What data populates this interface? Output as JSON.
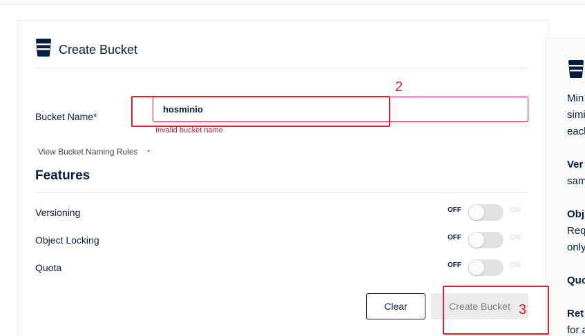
{
  "form": {
    "title": "Create Bucket",
    "bucket_name_label": "Bucket Name*",
    "bucket_name_value": "hosminio",
    "error": "Invalid bucket name",
    "naming_rules_link": "View Bucket Naming Rules",
    "features_heading": "Features",
    "features": [
      {
        "label": "Versioning",
        "off": "OFF",
        "on": "ON",
        "enabled": false
      },
      {
        "label": "Object Locking",
        "off": "OFF",
        "on": "ON",
        "enabled": false
      },
      {
        "label": "Quota",
        "off": "OFF",
        "on": "ON",
        "enabled": false
      }
    ],
    "clear_label": "Clear",
    "create_label": "Create Bucket"
  },
  "side_panel": {
    "lines": [
      "Min",
      "simi",
      "each",
      "Ver",
      "sam",
      "Obj",
      "Req",
      "only",
      "Quo",
      "Ret",
      "for a"
    ]
  },
  "annotations": {
    "input_marker": "2",
    "create_marker": "3"
  },
  "colors": {
    "primary": "#081c42",
    "error": "#c51b3f",
    "annotation": "#ec1c24"
  }
}
